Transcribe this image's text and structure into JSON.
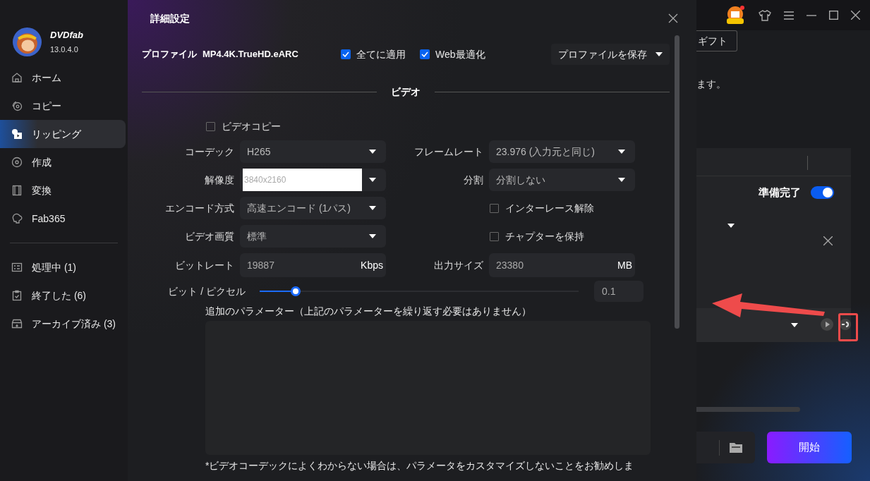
{
  "app": {
    "name": "DVDfab",
    "version": "13.0.4.0"
  },
  "sidebar": {
    "items": [
      {
        "label": "ホーム",
        "selected": false
      },
      {
        "label": "コピー",
        "selected": false
      },
      {
        "label": "リッピング",
        "selected": true
      },
      {
        "label": "作成",
        "selected": false
      },
      {
        "label": "変換",
        "selected": false
      },
      {
        "label": "Fab365",
        "selected": false
      }
    ],
    "queue": [
      {
        "label": "処理中 (1)"
      },
      {
        "label": "終了した (6)"
      },
      {
        "label": "アーカイブ済み (3)"
      }
    ]
  },
  "dialog": {
    "title": "詳細設定",
    "profile_label": "プロファイル",
    "profile_name": "MP4.4K.TrueHD.eARC",
    "options": [
      {
        "label": "全てに適用",
        "checked": true
      },
      {
        "label": "Web最適化",
        "checked": true
      }
    ],
    "save_profile": "プロファイルを保存",
    "section": "ビデオ",
    "video_copy": {
      "label": "ビデオコピー",
      "checked": false
    },
    "rows": [
      {
        "left": {
          "label": "コーデック",
          "kind": "select",
          "value": "H265"
        },
        "right": {
          "label": "フレームレート",
          "kind": "select",
          "value": "23.976 (入力元と同じ)"
        }
      },
      {
        "left": {
          "label": "解像度",
          "kind": "combo",
          "value": "3840x2160"
        },
        "right": {
          "label": "分割",
          "kind": "select",
          "value": "分割しない"
        }
      },
      {
        "left": {
          "label": "エンコード方式",
          "kind": "select",
          "value": "高速エンコード (1パス)"
        },
        "right": {
          "label": "インターレース解除",
          "kind": "checkbox",
          "checked": false
        }
      },
      {
        "left": {
          "label": "ビデオ画質",
          "kind": "select",
          "value": "標準"
        },
        "right": {
          "label": "チャプターを保持",
          "kind": "checkbox",
          "checked": false
        }
      },
      {
        "left": {
          "label": "ビットレート",
          "kind": "unit",
          "value": "19887",
          "unit": "Kbps"
        },
        "right": {
          "label": "出力サイズ",
          "kind": "unit",
          "value": "23380",
          "unit": "MB"
        }
      }
    ],
    "slider": {
      "label": "ビット / ピクセル",
      "level": 0.1,
      "reading": "0.1"
    },
    "params_label": "追加のパラメーター（上記のパラメーターを繰り返す必要はありません）",
    "note": "*ビデオコーデックによくわからない場合は、パラメータをカスタマイズしないことをお勧めしま"
  },
  "background": {
    "gift_button": "ギフト",
    "message": "ます。",
    "ready_label": "準備完了",
    "ready_on": true,
    "start_button": "開始"
  }
}
